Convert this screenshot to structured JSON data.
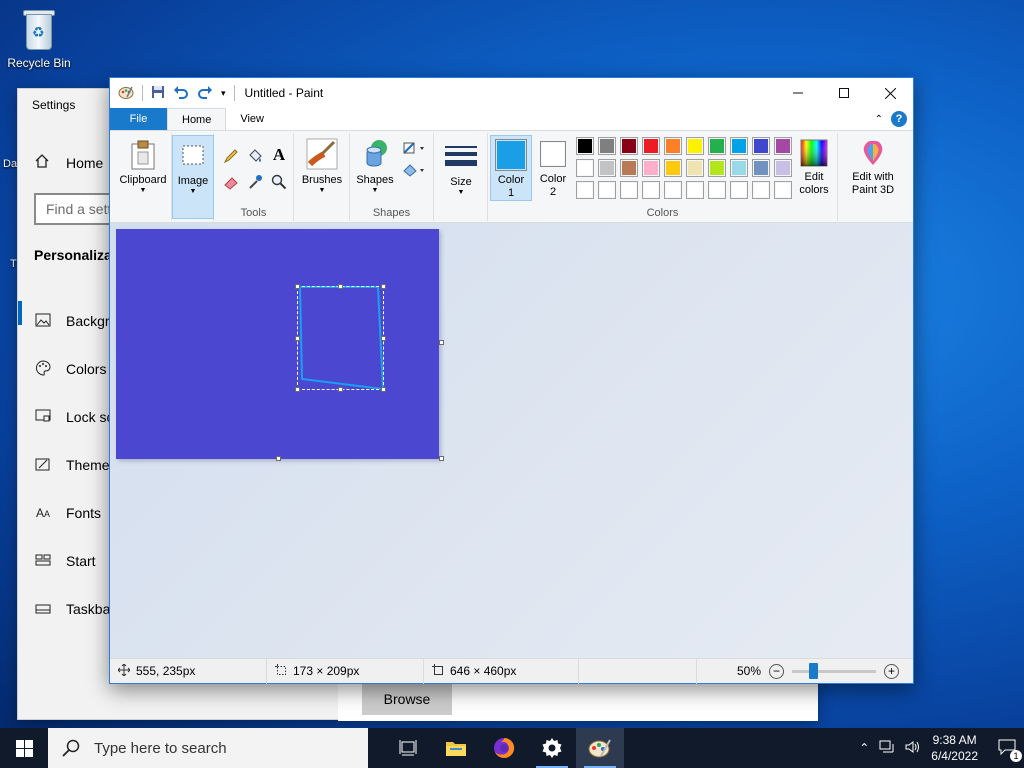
{
  "desktop": {
    "recycle_bin_label": "Recycle Bin",
    "partial_icon_label_1": "Da",
    "partial_icon_label_2": "T"
  },
  "settings": {
    "title": "Settings",
    "home_label": "Home",
    "search_placeholder": "Find a sett",
    "section_heading": "Personalizat",
    "nav": [
      {
        "label": "Backgro",
        "icon": "picture-icon"
      },
      {
        "label": "Colors",
        "icon": "palette-icon"
      },
      {
        "label": "Lock sc",
        "icon": "lock-screen-icon"
      },
      {
        "label": "Themes",
        "icon": "themes-icon"
      },
      {
        "label": "Fonts",
        "icon": "fonts-icon"
      },
      {
        "label": "Start",
        "icon": "start-icon"
      },
      {
        "label": "Taskbar",
        "icon": "taskbar-icon"
      }
    ],
    "browse_label": "Browse"
  },
  "paint": {
    "title": "Untitled - Paint",
    "tabs": {
      "file": "File",
      "home": "Home",
      "view": "View"
    },
    "ribbon": {
      "clipboard_label": "Clipboard",
      "image_label": "Image",
      "tools_group": "Tools",
      "brushes_label": "Brushes",
      "shapes_label": "Shapes",
      "shapes_group": "Shapes",
      "size_label": "Size",
      "color1_label_a": "Color",
      "color1_label_b": "1",
      "color2_label_a": "Color",
      "color2_label_b": "2",
      "colors_group": "Colors",
      "edit_colors_a": "Edit",
      "edit_colors_b": "colors",
      "paint3d_a": "Edit with",
      "paint3d_b": "Paint 3D"
    },
    "color1": "#1a9ee6",
    "color2": "#ffffff",
    "canvas_color": "#4b47d1",
    "palette_row1": [
      "#000000",
      "#7f7f7f",
      "#880015",
      "#ed1c24",
      "#ff7f27",
      "#fff200",
      "#22b14c",
      "#00a2e8",
      "#3f48cc",
      "#a349a4"
    ],
    "palette_row2": [
      "#ffffff",
      "#c3c3c3",
      "#b97a57",
      "#ffaec9",
      "#ffc90e",
      "#efe4b0",
      "#b5e61d",
      "#99d9ea",
      "#7092be",
      "#c8bfe7"
    ],
    "palette_row3": [
      "#ffffff",
      "#ffffff",
      "#ffffff",
      "#ffffff",
      "#ffffff",
      "#ffffff",
      "#ffffff",
      "#ffffff",
      "#ffffff",
      "#ffffff"
    ],
    "status": {
      "cursor_pos": "555, 235px",
      "selection_size": "173 × 209px",
      "image_size": "646 × 460px",
      "zoom": "50%"
    },
    "zoom_fraction": 0.25
  },
  "taskbar": {
    "search_placeholder": "Type here to search",
    "time": "9:38 AM",
    "date": "6/4/2022",
    "notification_count": "1"
  }
}
